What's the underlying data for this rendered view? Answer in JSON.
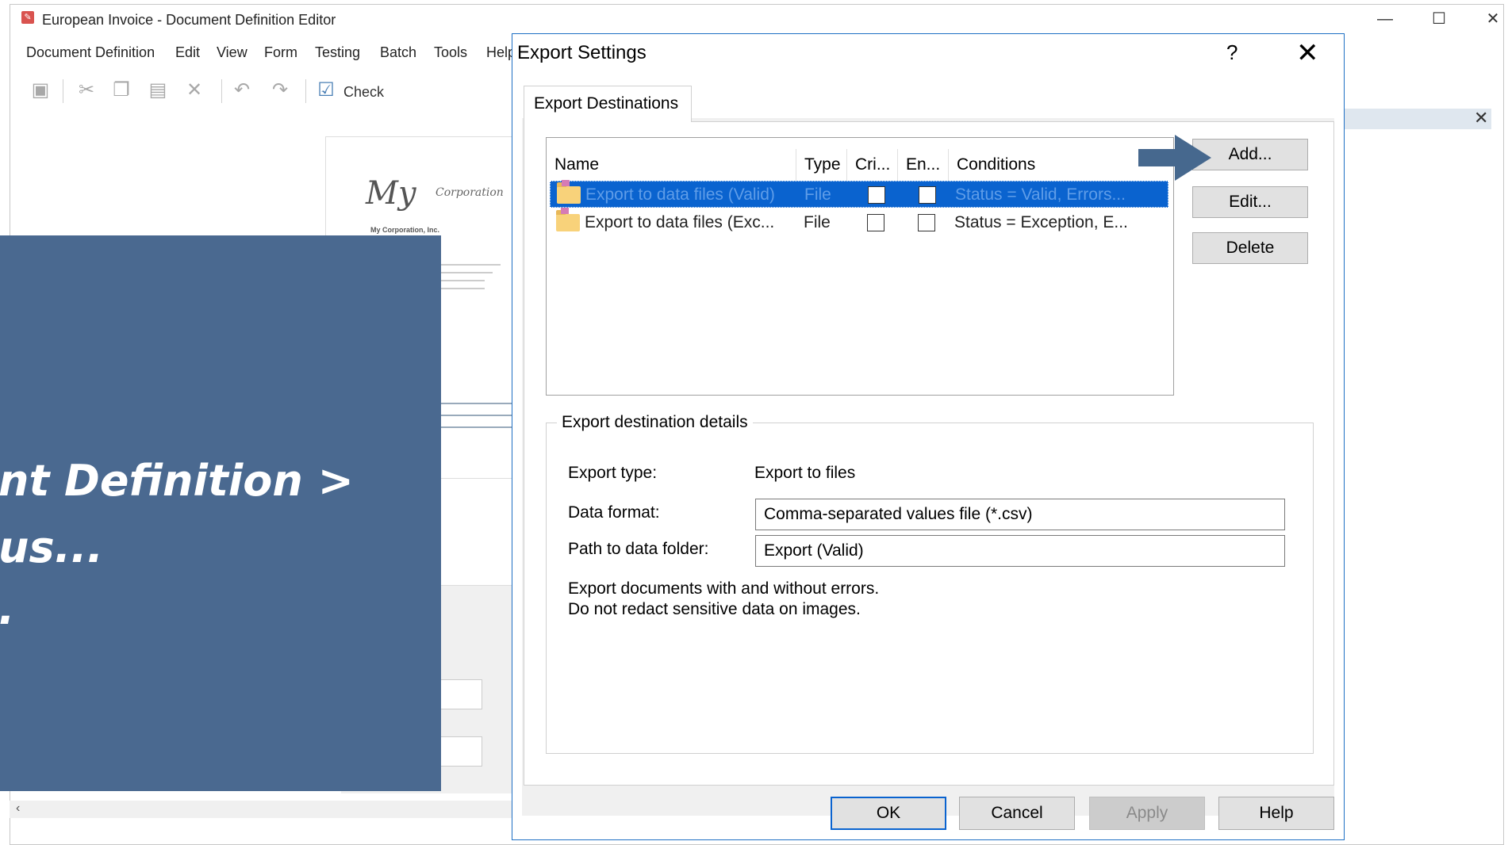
{
  "app": {
    "title": "European Invoice - Document Definition Editor",
    "menu": [
      "Document Definition",
      "Edit",
      "View",
      "Form",
      "Testing",
      "Batch",
      "Tools",
      "Help"
    ],
    "toolbar_check_label": "Check"
  },
  "document_preview": {
    "logo": "My",
    "logo_sub": "Corporation",
    "company": "My Corporation, Inc."
  },
  "overlay": {
    "lines": [
      "nt Definition >",
      "us...",
      "."
    ]
  },
  "dialog": {
    "title": "Export Settings",
    "help_glyph": "?",
    "tab_label": "Export Destinations",
    "columns": [
      "Name",
      "Type",
      "Cri...",
      "En...",
      "Conditions"
    ],
    "rows": [
      {
        "name": "Export to data files (Valid)",
        "type": "File",
        "critical": false,
        "enabled": false,
        "conditions": "Status = Valid, Errors...",
        "selected": true
      },
      {
        "name": "Export to data files (Exc...",
        "type": "File",
        "critical": false,
        "enabled": false,
        "conditions": "Status = Exception, E...",
        "selected": false
      }
    ],
    "buttons": {
      "add": "Add...",
      "edit": "Edit...",
      "delete": "Delete"
    },
    "details": {
      "group_label": "Export destination details",
      "export_type_label": "Export type:",
      "export_type_value": "Export to files",
      "data_format_label": "Data format:",
      "data_format_value": "Comma-separated values file (*.csv)",
      "path_label": "Path to data folder:",
      "path_value": "Export (Valid)",
      "note_line1": "Export documents with and without errors.",
      "note_line2": "Do not redact sensitive data on images."
    },
    "footer": {
      "ok": "OK",
      "cancel": "Cancel",
      "apply": "Apply",
      "help": "Help"
    }
  },
  "colors": {
    "overlay": "#4a6990",
    "selection": "#0a63cf",
    "arrow": "#46688e",
    "dialog_border": "#1e6fc4"
  }
}
